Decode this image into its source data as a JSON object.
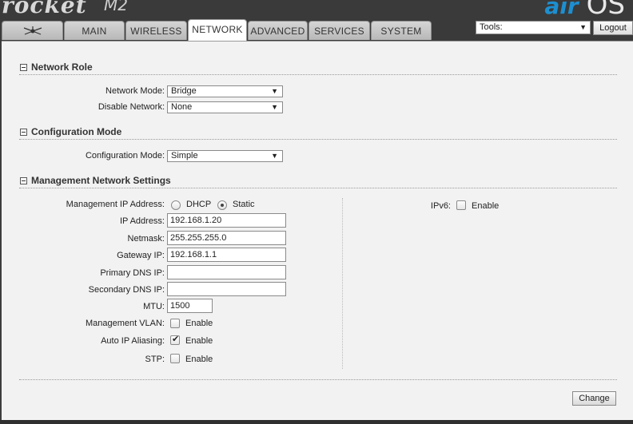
{
  "header": {
    "brand": "rocket",
    "model": "M2",
    "os_prefix": "air",
    "os_suffix": "OS"
  },
  "tabs": [
    {
      "label": ""
    },
    {
      "label": "MAIN"
    },
    {
      "label": "WIRELESS"
    },
    {
      "label": "NETWORK"
    },
    {
      "label": "ADVANCED"
    },
    {
      "label": "SERVICES"
    },
    {
      "label": "SYSTEM"
    }
  ],
  "active_tab": "NETWORK",
  "tools": {
    "selected": "Tools:",
    "logout_label": "Logout"
  },
  "sections": {
    "network_role": {
      "title": "Network Role",
      "network_mode_label": "Network Mode:",
      "network_mode_value": "Bridge",
      "disable_network_label": "Disable Network:",
      "disable_network_value": "None"
    },
    "configuration_mode": {
      "title": "Configuration Mode",
      "label": "Configuration Mode:",
      "value": "Simple"
    },
    "management": {
      "title": "Management Network Settings",
      "mgmt_ip_label": "Management IP Address:",
      "dhcp_label": "DHCP",
      "static_label": "Static",
      "ip_label": "IP Address:",
      "ip_value": "192.168.1.20",
      "netmask_label": "Netmask:",
      "netmask_value": "255.255.255.0",
      "gateway_label": "Gateway IP:",
      "gateway_value": "192.168.1.1",
      "primary_dns_label": "Primary DNS IP:",
      "primary_dns_value": "",
      "secondary_dns_label": "Secondary DNS IP:",
      "secondary_dns_value": "",
      "mtu_label": "MTU:",
      "mtu_value": "1500",
      "vlan_label": "Management VLAN:",
      "auto_alias_label": "Auto IP Aliasing:",
      "stp_label": "STP:",
      "enable_label": "Enable",
      "ipv6_label": "IPv6:"
    }
  },
  "states": {
    "static_selected": true,
    "vlan_enabled": false,
    "auto_alias_enabled": true,
    "stp_enabled": false,
    "ipv6_enabled": false
  },
  "buttons": {
    "change_label": "Change"
  },
  "colors": {
    "accent_blue": "#1d8fd0",
    "header_bg": "#3a3a3a",
    "content_bg": "#f2f2f2"
  }
}
